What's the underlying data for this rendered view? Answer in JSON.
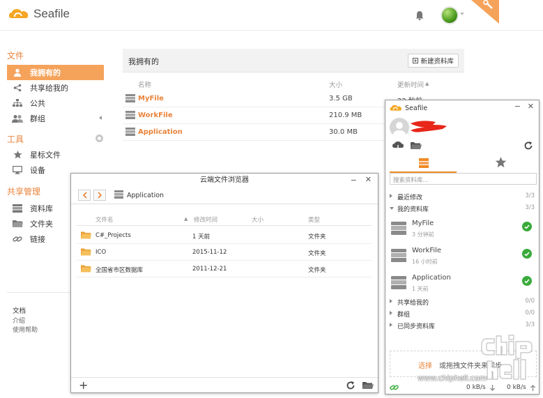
{
  "header": {
    "app_name": "Seafile",
    "colors": {
      "accent": "#f5a35b",
      "brand": "#f08a24"
    }
  },
  "sidebar": {
    "files_heading": "文件",
    "files_items": [
      {
        "label": "我拥有的",
        "icon": "user-icon",
        "active": true
      },
      {
        "label": "共享给我的",
        "icon": "share-icon"
      },
      {
        "label": "公共",
        "icon": "org-icon"
      },
      {
        "label": "群组",
        "icon": "group-icon"
      }
    ],
    "tools_heading": "工具",
    "tools_items": [
      {
        "label": "星标文件",
        "icon": "star-icon"
      },
      {
        "label": "设备",
        "icon": "monitor-icon"
      }
    ],
    "share_heading": "共享管理",
    "share_items": [
      {
        "label": "资料库",
        "icon": "library-icon"
      },
      {
        "label": "文件夹",
        "icon": "folder-icon"
      },
      {
        "label": "链接",
        "icon": "link-icon"
      }
    ],
    "footer_title": "文档",
    "footer_links": [
      "介绍",
      "使用帮助"
    ]
  },
  "main": {
    "title": "我拥有的",
    "new_library_label": "新建资料库",
    "columns": {
      "name": "名称",
      "size": "大小",
      "updated": "更新时间"
    },
    "rows": [
      {
        "name": "MyFile",
        "size": "3.5 GB",
        "time": "22 秒前"
      },
      {
        "name": "WorkFile",
        "size": "210.9 MB",
        "time": ""
      },
      {
        "name": "Application",
        "size": "30.0 MB",
        "time": ""
      }
    ]
  },
  "browser": {
    "title": "云端文件浏览器",
    "path": "Application",
    "columns": {
      "name": "文件名",
      "mtime": "修改时间",
      "size": "大小",
      "type": "类型"
    },
    "rows": [
      {
        "name": "C#_Projects",
        "time": "1 天前",
        "type": "文件夹"
      },
      {
        "name": "ICO",
        "time": "2015-11-12",
        "type": "文件夹"
      },
      {
        "name": "全国省市区数据库",
        "time": "2011-12-21",
        "type": "文件夹"
      }
    ]
  },
  "client": {
    "title": "Seafile",
    "search_placeholder": "搜索资料库...",
    "sections": {
      "recent": {
        "label": "最近修改",
        "count": "3/3"
      },
      "mine": {
        "label": "我的资料库",
        "count": "3/3"
      },
      "shared": {
        "label": "共享给我的",
        "count": "0/0"
      },
      "groups": {
        "label": "群组",
        "count": "0/0"
      },
      "synced": {
        "label": "已同步资料库",
        "count": "3/3"
      }
    },
    "repos": [
      {
        "name": "MyFile",
        "sub": "3 分钟前"
      },
      {
        "name": "WorkFile",
        "sub": "16 小时前"
      },
      {
        "name": "Application",
        "sub": "1 天前"
      }
    ],
    "drop_select": "选择",
    "drop_rest": "或拖拽文件夹来同步",
    "download_rate": "0 kB/s",
    "upload_rate": "0 kB/s"
  },
  "watermark": {
    "text": "www.chiphell.com"
  }
}
